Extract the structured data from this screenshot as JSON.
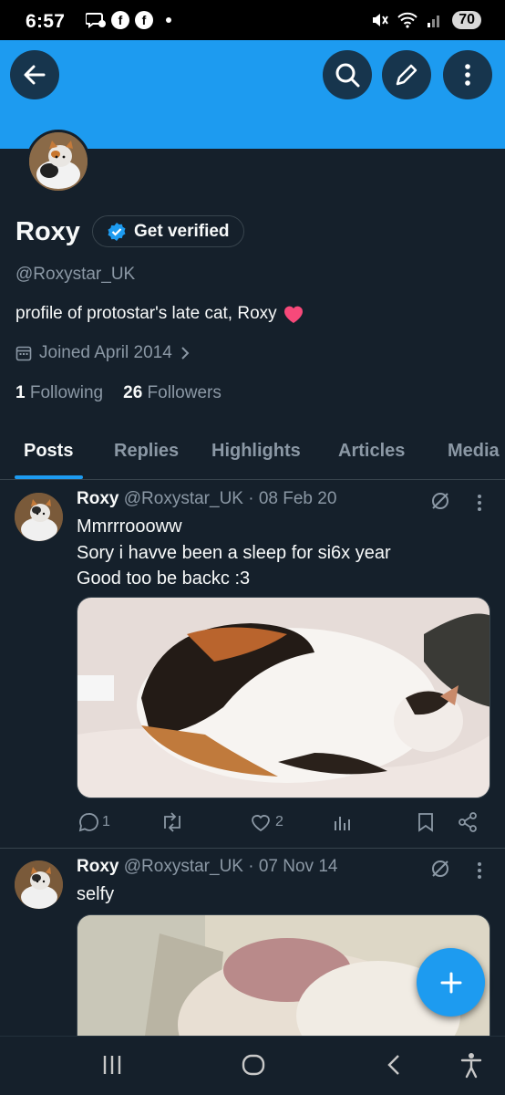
{
  "status_bar": {
    "time": "6:57",
    "battery": "70"
  },
  "profile": {
    "name": "Roxy",
    "verify_label": "Get verified",
    "handle": "@Roxystar_UK",
    "bio": "profile of protostar's late cat, Roxy",
    "joined": "Joined April 2014",
    "following_count": "1",
    "following_label": "Following",
    "followers_count": "26",
    "followers_label": "Followers"
  },
  "tabs": [
    {
      "label": "Posts",
      "active": true
    },
    {
      "label": "Replies"
    },
    {
      "label": "Highlights"
    },
    {
      "label": "Articles"
    },
    {
      "label": "Media"
    }
  ],
  "posts": [
    {
      "name": "Roxy",
      "handle_date": "@Roxystar_UK · 08 Feb 20",
      "lines": [
        "Mmrrroooww",
        "Sory i havve been a sleep for si6x year",
        "Good too be backc :3"
      ],
      "replies": "1",
      "reposts": "",
      "likes": "2"
    },
    {
      "name": "Roxy",
      "handle_date": "@Roxystar_UK · 07 Nov 14",
      "lines": [
        "selfy"
      ]
    }
  ],
  "colors": {
    "accent": "#1d9bf0",
    "background": "#15202b",
    "secondary_text": "#8b98a5",
    "border": "#38444d"
  }
}
